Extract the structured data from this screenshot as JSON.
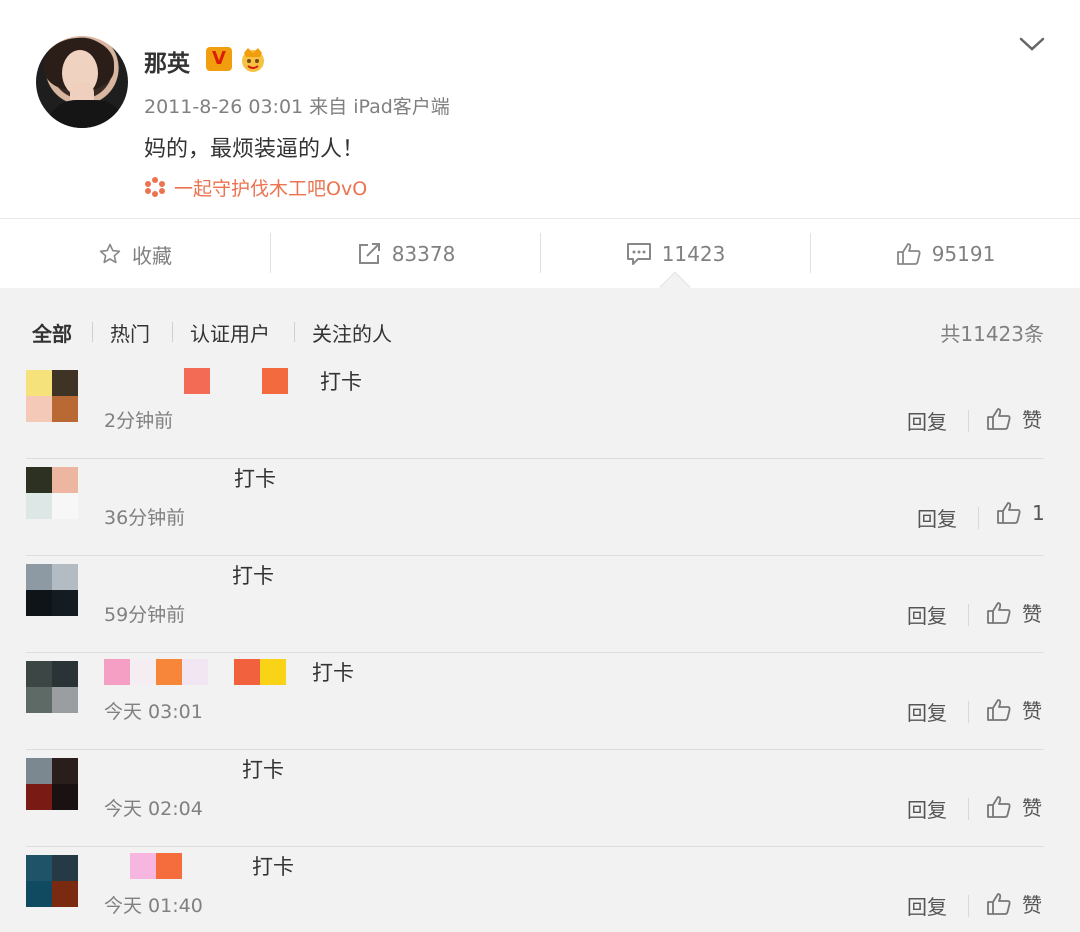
{
  "post": {
    "username": "那英",
    "verified_badge": "V",
    "meta": "2011-8-26 03:01 来自 iPad客户端",
    "content": "妈的，最烦装逼的人！",
    "topic": "一起守护伐木工吧OvO",
    "icons": [
      "avatar",
      "verified-v-icon",
      "crown-icon",
      "flower-icon",
      "chevron-down-icon"
    ]
  },
  "actions": {
    "favorite_label": "收藏",
    "repost_count": "83378",
    "comment_count": "11423",
    "like_count": "95191"
  },
  "filters": {
    "items": [
      "全部",
      "热门",
      "认证用户",
      "关注的人"
    ],
    "active": "全部",
    "total": "共11423条"
  },
  "comments": [
    {
      "text": "打卡",
      "time": "2分钟前",
      "reply": "回复",
      "like": "赞"
    },
    {
      "text": "打卡",
      "time": "36分钟前",
      "reply": "回复",
      "like": "1"
    },
    {
      "text": "打卡",
      "time": "59分钟前",
      "reply": "回复",
      "like": "赞"
    },
    {
      "text": "打卡",
      "time": "今天 03:01",
      "reply": "回复",
      "like": "赞"
    },
    {
      "text": "打卡",
      "time": "今天 02:04",
      "reply": "回复",
      "like": "赞"
    },
    {
      "text": "打卡",
      "time": "今天 01:40",
      "reply": "回复",
      "like": "赞"
    }
  ],
  "colors": {
    "accent": "#eb7350",
    "text": "#333333",
    "muted": "#808080",
    "badge": "#f29d0d",
    "background": "#f2f2f2"
  }
}
